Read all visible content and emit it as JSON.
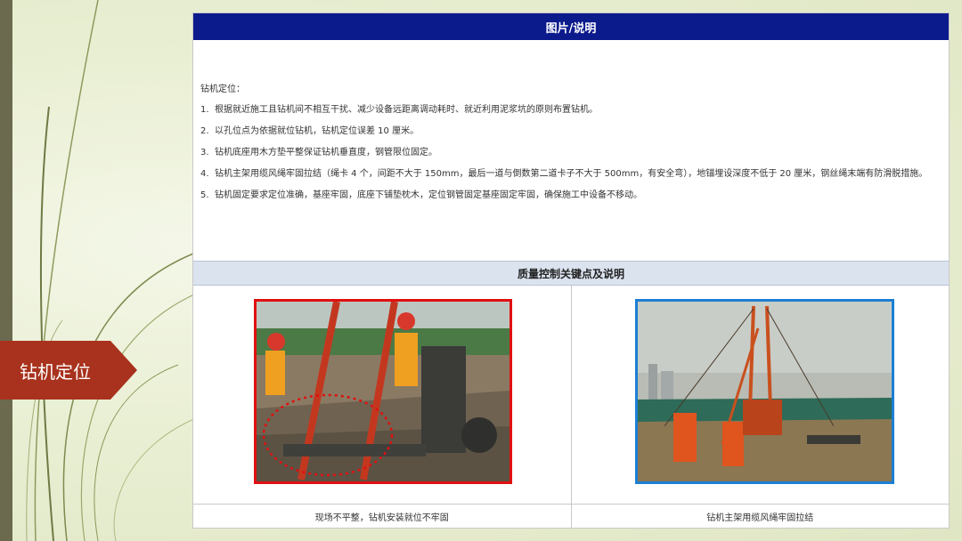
{
  "slide": {
    "side_title": "钻机定位"
  },
  "panel": {
    "header": "图片/说明",
    "intro": "钻机定位：",
    "items": [
      {
        "num": "1.",
        "text": "根据就近施工且钻机间不相互干扰、减少设备远距离调动耗时、就近利用泥浆坑的原则布置钻机。"
      },
      {
        "num": "2.",
        "text": "以孔位点为依据就位钻机，钻机定位误差 10 厘米。"
      },
      {
        "num": "3.",
        "text": "钻机底座用木方垫平整保证钻机垂直度，钢管限位固定。"
      },
      {
        "num": "4.",
        "text": "钻机主架用缆风绳牢固拉结（绳卡 4 个，间距不大于 150mm，最后一道与倒数第二道卡子不大于 500mm，有安全弯），地锚埋设深度不低于 20 厘米，钢丝绳末端有防滑脱措施。"
      },
      {
        "num": "5.",
        "text": "钻机固定要求定位准确，基座牢固，底座下铺垫枕木，定位钢管固定基座固定牢固，确保施工中设备不移动。"
      }
    ],
    "sub_header": "质量控制关键点及说明",
    "captions": [
      "现场不平整，钻机安装就位不牢固",
      "钻机主架用缆风绳牢固拉结"
    ]
  }
}
